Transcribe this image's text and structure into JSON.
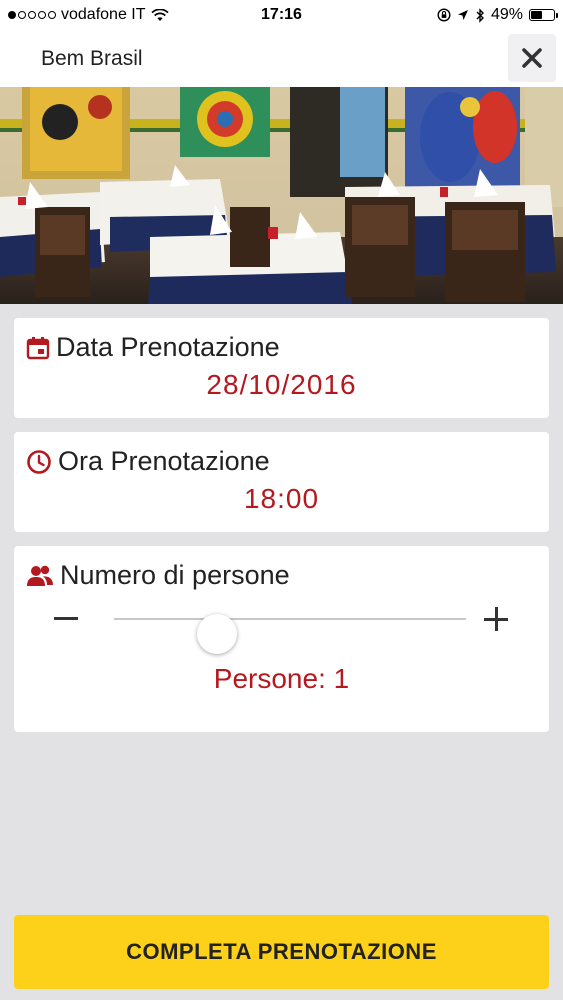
{
  "status_bar": {
    "carrier": "vodafone IT",
    "time": "17:16",
    "battery": "49%",
    "battery_level": 0.49,
    "signal_bars_filled": 1,
    "signal_bars_total": 5
  },
  "header": {
    "title": "Bem Brasil"
  },
  "hero": {
    "image": "restaurant-interior"
  },
  "booking": {
    "date_label": "Data Prenotazione",
    "date_value": "28/10/2016",
    "time_label": "Ora Prenotazione",
    "time_value": "18:00",
    "people_label": "Numero di persone",
    "people_count": "Persone: 1",
    "people_slider_value": 1
  },
  "footer": {
    "complete_label": "COMPLETA PRENOTAZIONE"
  },
  "colors": {
    "accent_red": "#b3191e",
    "button_yellow": "#fdd11a",
    "background": "#e2e2e4"
  }
}
